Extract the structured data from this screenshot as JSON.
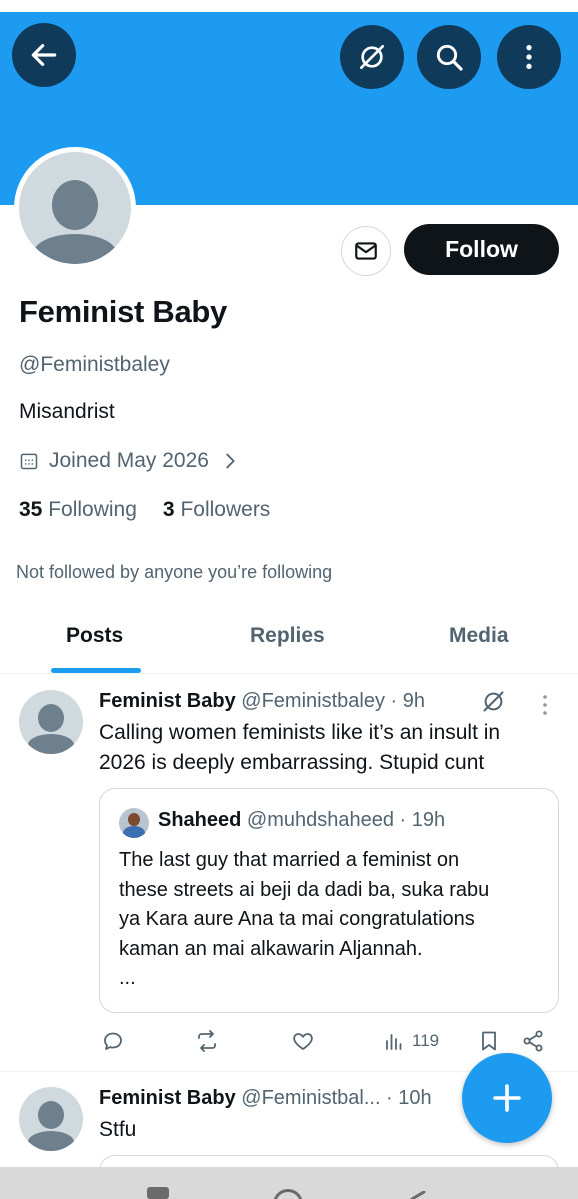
{
  "header": {
    "back_icon": "arrow-left-icon",
    "grok_icon": "slash-circle-icon",
    "search_icon": "search-icon",
    "more_icon": "more-vertical-icon",
    "banner_color": "#1d9bf0"
  },
  "profile": {
    "name": "Feminist Baby",
    "handle": "@Feministbaley",
    "bio": "Misandrist",
    "joined": "Joined May 2026",
    "following_count": "35",
    "following_label": "Following",
    "followers_count": "3",
    "followers_label": "Followers",
    "not_followed_text": "Not followed by anyone you’re following",
    "follow_button": "Follow",
    "message_icon": "envelope-icon"
  },
  "tabs": [
    {
      "label": "Posts",
      "active": true
    },
    {
      "label": "Replies",
      "active": false
    },
    {
      "label": "Media",
      "active": false
    }
  ],
  "posts": [
    {
      "author": "Feminist Baby",
      "handle_time": "@Feministbaley · 9h",
      "text_line1": "Calling women feminists like it’s an insult in",
      "text_line2": "2026 is deeply embarrassing. Stupid cunt",
      "quote": {
        "author": "Shaheed",
        "handle_time": "@muhdshaheed · 19h",
        "text_line1": "The last guy that married a feminist on",
        "text_line2": "these streets ai beji da dadi ba, suka rabu",
        "text_line3": "ya Kara aure Ana ta mai congratulations",
        "text_line4": "kaman an mai alkawarin Aljannah.",
        "text_line5": "..."
      },
      "views": "119"
    },
    {
      "author": "Feminist Baby",
      "handle_time": "@Feministbal... · 10h",
      "text": "Stfu"
    }
  ],
  "fab_icon": "plus-icon",
  "accent_color": "#1d9bf0"
}
